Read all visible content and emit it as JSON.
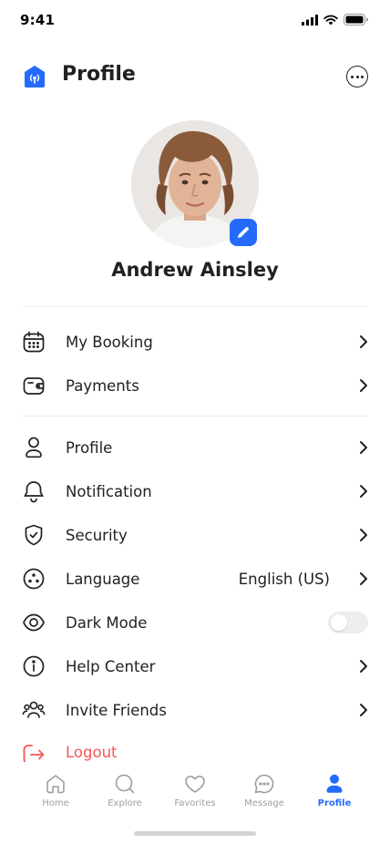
{
  "status_bar": {
    "time": "9:41"
  },
  "header": {
    "title": "Profile",
    "logo_icon": "home-signal-icon",
    "more_icon": "more-circle-icon"
  },
  "user": {
    "name": "Andrew Ainsley"
  },
  "colors": {
    "primary": "#246BFD",
    "danger": "#F75555",
    "text": "#212121",
    "muted": "#9E9E9E"
  },
  "menu": {
    "group1": [
      {
        "label": "My Booking",
        "icon": "calendar-icon"
      },
      {
        "label": "Payments",
        "icon": "wallet-icon"
      }
    ],
    "group2": [
      {
        "label": "Profile",
        "icon": "user-icon"
      },
      {
        "label": "Notification",
        "icon": "bell-icon"
      },
      {
        "label": "Security",
        "icon": "shield-check-icon"
      },
      {
        "label": "Language",
        "icon": "language-icon",
        "value": "English (US)"
      },
      {
        "label": "Dark Mode",
        "icon": "eye-icon",
        "toggle_on": false
      },
      {
        "label": "Help Center",
        "icon": "info-icon"
      },
      {
        "label": "Invite Friends",
        "icon": "users-icon"
      }
    ],
    "logout": {
      "label": "Logout",
      "icon": "logout-icon"
    }
  },
  "bottom_nav": [
    {
      "label": "Home",
      "icon": "home-icon",
      "active": false
    },
    {
      "label": "Explore",
      "icon": "search-icon",
      "active": false
    },
    {
      "label": "Favorites",
      "icon": "heart-icon",
      "active": false
    },
    {
      "label": "Message",
      "icon": "chat-icon",
      "active": false
    },
    {
      "label": "Profile",
      "icon": "profile-icon",
      "active": true
    }
  ]
}
